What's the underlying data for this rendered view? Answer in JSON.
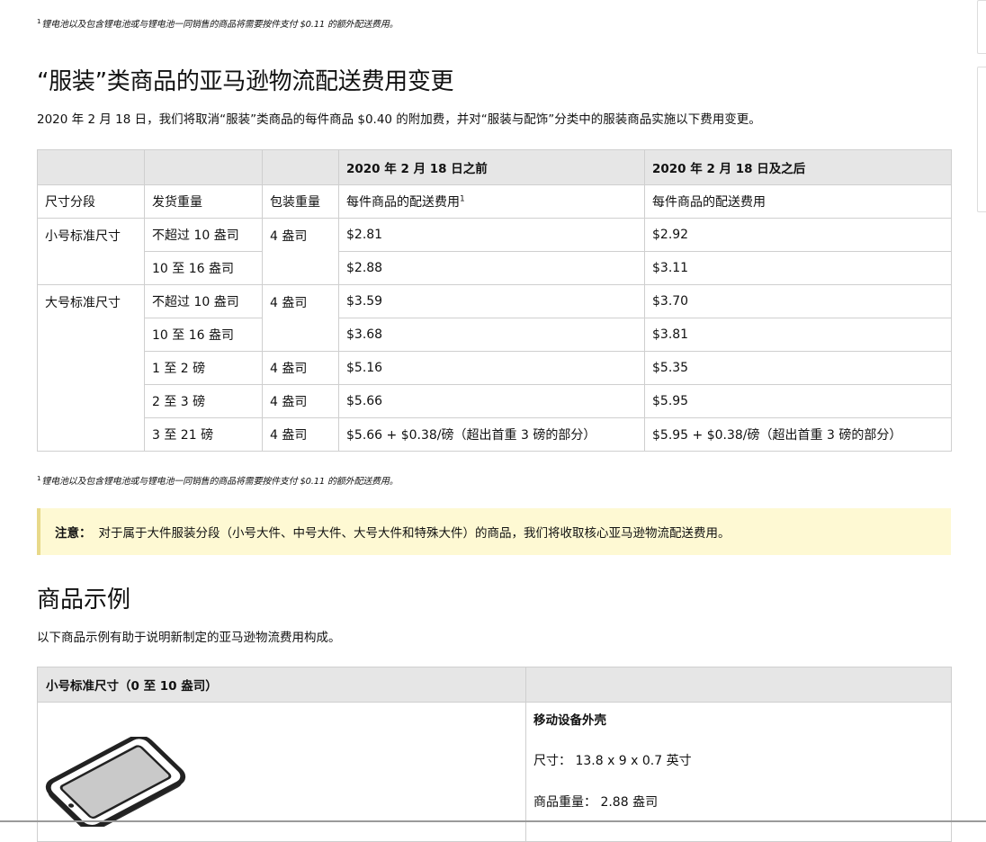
{
  "footnote": {
    "marker": "1",
    "text": "锂电池以及包含锂电池或与锂电池一同销售的商品将需要按件支付 $0.11 的额外配送费用。"
  },
  "fee_section": {
    "title": "“服装”类商品的亚马逊物流配送费用变更",
    "intro": "2020 年 2 月 18 日，我们将取消“服装”类商品的每件商品 $0.40 的附加费，并对“服装与配饰”分类中的服装商品实施以下费用变更。"
  },
  "fee_table": {
    "group_headers": [
      "",
      "",
      "",
      "2020 年 2 月 18 日之前",
      "2020 年 2 月 18 日及之后"
    ],
    "col_headers": [
      "尺寸分段",
      "发货重量",
      "包装重量",
      "每件商品的配送费用",
      "每件商品的配送费用"
    ],
    "col_footnote": "1",
    "rows": [
      {
        "tier": "小号标准尺寸",
        "weight": "不超过 10 盎司",
        "pack": "4 盎司",
        "before": "$2.81",
        "after": "$2.92"
      },
      {
        "tier": "",
        "weight": "10 至 16 盎司",
        "pack": "",
        "before": "$2.88",
        "after": "$3.11"
      },
      {
        "tier": "大号标准尺寸",
        "weight": "不超过 10 盎司",
        "pack": "4 盎司",
        "before": "$3.59",
        "after": "$3.70"
      },
      {
        "tier": "",
        "weight": "10 至 16 盎司",
        "pack": "",
        "before": "$3.68",
        "after": "$3.81"
      },
      {
        "tier": "",
        "weight": "1 至 2 磅",
        "pack": "4 盎司",
        "before": "$5.16",
        "after": "$5.35"
      },
      {
        "tier": "",
        "weight": "2 至 3 磅",
        "pack": "4 盎司",
        "before": "$5.66",
        "after": "$5.95"
      },
      {
        "tier": "",
        "weight": "3 至 21 磅",
        "pack": "4 盎司",
        "before": "$5.66 + $0.38/磅（超出首重 3 磅的部分）",
        "after": "$5.95 + $0.38/磅（超出首重 3 磅的部分）"
      }
    ]
  },
  "note": {
    "label": "注意：",
    "text": "对于属于大件服装分段（小号大件、中号大件、大号大件和特殊大件）的商品，我们将收取核心亚马逊物流配送费用。"
  },
  "examples_section": {
    "title": "商品示例",
    "intro": "以下商品示例有助于说明新制定的亚马逊物流费用构成。"
  },
  "example_table": {
    "header_left": "小号标准尺寸（0 至 10 盎司）",
    "header_right": "",
    "item": {
      "icon": "tablet-device-icon",
      "name": "移动设备外壳",
      "size": "尺寸： 13.8 x 9 x 0.7 英寸",
      "weight": "商品重量： 2.88 盎司"
    }
  },
  "colors": {
    "table_header_bg": "#e6e6e6",
    "note_bg": "#fef9d3",
    "note_border": "#e8d98a",
    "border": "#cfcfcf"
  }
}
